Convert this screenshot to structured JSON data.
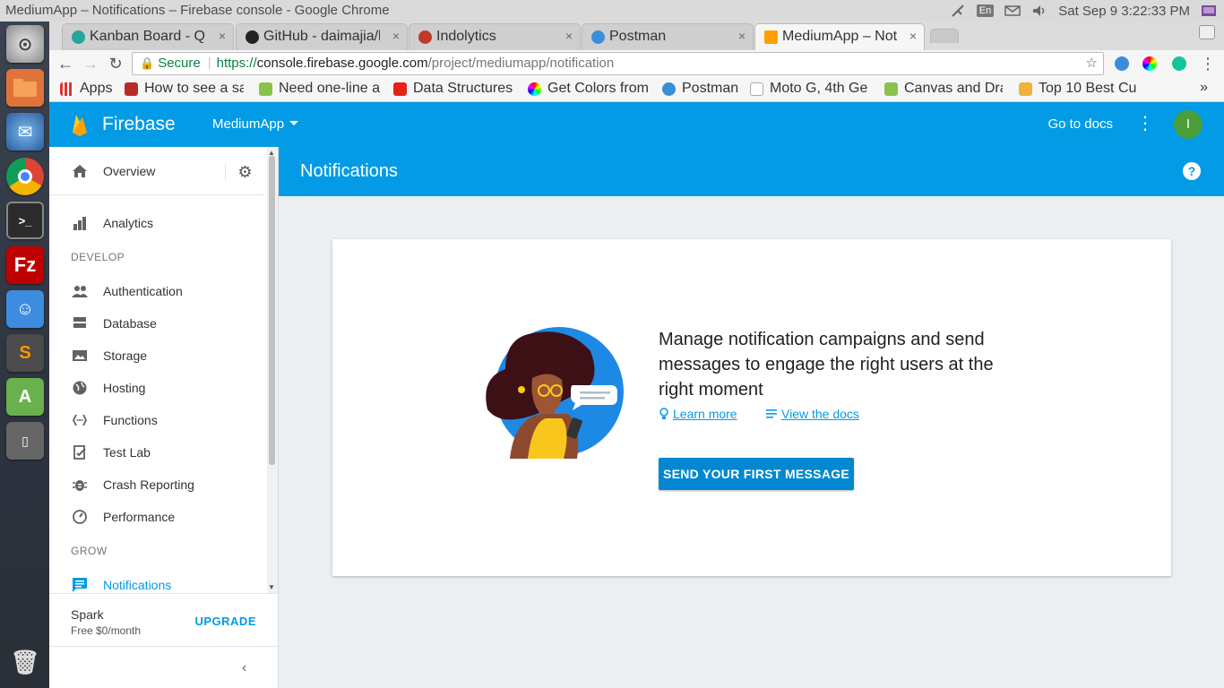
{
  "os": {
    "window_title": "MediumApp – Notifications – Firebase console - Google Chrome",
    "keyboard": "En",
    "clock": "Sat Sep  9  3:22:33 PM"
  },
  "tabs": [
    {
      "label": "Kanban Board - Qu",
      "close": "×"
    },
    {
      "label": "GitHub - daimajia/l",
      "close": "×"
    },
    {
      "label": "Indolytics",
      "close": "×"
    },
    {
      "label": "Postman",
      "close": "×"
    },
    {
      "label": "MediumApp – Not",
      "close": "×"
    }
  ],
  "omnibox": {
    "secure": "Secure",
    "scheme": "https://",
    "host": "console.firebase.google.com",
    "path": "/project/mediumapp/notification"
  },
  "bookmarks": [
    "Apps",
    "How to see a sa",
    "Need one-line a",
    "Data Structures",
    "Get Colors from",
    "Postman",
    "Moto G, 4th Ge",
    "Canvas and Dra",
    "Top 10 Best Cu"
  ],
  "bookmarks_more": "»",
  "firebase": {
    "brand": "Firebase",
    "project": "MediumApp",
    "docs_link": "Go to docs",
    "avatar_initial": "I"
  },
  "sidebar": {
    "overview": "Overview",
    "analytics": "Analytics",
    "develop_section": "DEVELOP",
    "develop": [
      "Authentication",
      "Database",
      "Storage",
      "Hosting",
      "Functions",
      "Test Lab",
      "Crash Reporting",
      "Performance"
    ],
    "grow_section": "GROW",
    "notifications": "Notifications",
    "plan_name": "Spark",
    "plan_price": "Free $0/month",
    "upgrade": "UPGRADE",
    "collapse": "‹"
  },
  "page": {
    "title": "Notifications",
    "help": "?"
  },
  "card": {
    "headline": "Manage notification campaigns and send messages to engage the right users at the right moment",
    "learn_more": "Learn more",
    "view_docs": "View the docs",
    "cta": "SEND YOUR FIRST MESSAGE"
  },
  "colors": {
    "firebase_blue": "#039be5",
    "cta_blue": "#0288d1",
    "content_bg": "#eceff1"
  }
}
